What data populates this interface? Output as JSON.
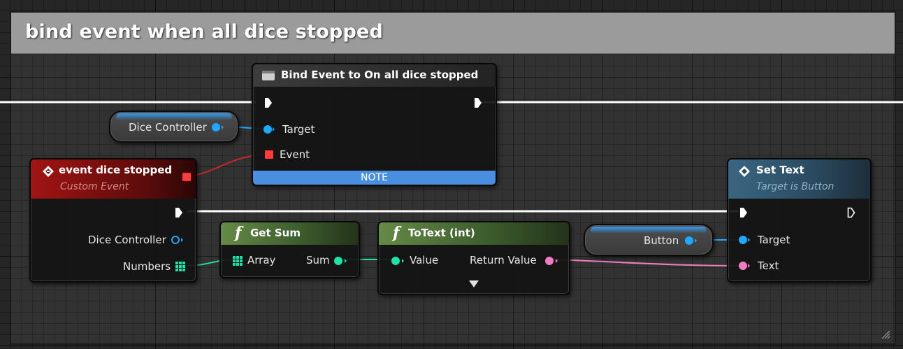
{
  "comment": {
    "title": "bind event when all dice stopped"
  },
  "colors": {
    "exec": "#ffffff",
    "object_pin": "#1ea8ff",
    "delegate_pin": "#ff3a3a",
    "int_pin": "#1fe0a6",
    "string_pin": "#f07dc0",
    "event_header": "#8a1414",
    "function_header": "#557a3c",
    "target_function_header": "#3d6d8a",
    "note": "#4a8ee0",
    "comment_header": "#9b9b9b"
  },
  "nodes": {
    "bind_event": {
      "title": "Bind Event to On all dice stopped",
      "icon": "bind-event-icon",
      "pins": {
        "target": "Target",
        "event": "Event"
      },
      "note": "NOTE"
    },
    "dice_controller_var": {
      "label": "Dice Controller"
    },
    "custom_event": {
      "icon": "event-icon",
      "title": "event dice stopped",
      "subtitle": "Custom Event",
      "pins": {
        "dice_controller": "Dice Controller",
        "numbers": "Numbers"
      }
    },
    "get_sum": {
      "icon": "function-icon",
      "title": "Get Sum",
      "pins": {
        "array": "Array",
        "sum": "Sum"
      }
    },
    "to_text": {
      "icon": "function-icon",
      "title": "ToText (int)",
      "pins": {
        "value": "Value",
        "return_value": "Return Value"
      },
      "expand_icon": "chevron-down-icon"
    },
    "button_var": {
      "label": "Button"
    },
    "set_text": {
      "icon": "event-icon",
      "title": "Set Text",
      "subtitle": "Target is Button",
      "pins": {
        "target": "Target",
        "text": "Text"
      }
    }
  }
}
